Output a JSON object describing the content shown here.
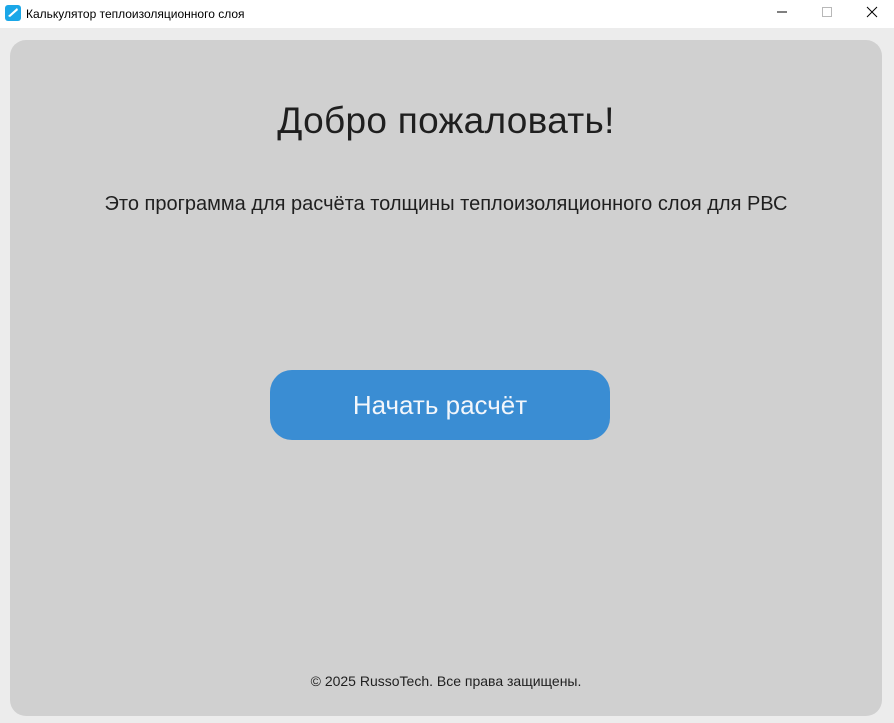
{
  "window": {
    "title": "Калькулятор теплоизоляционного слоя",
    "icon": "app-icon",
    "controls": {
      "minimize_icon": "minimize-icon",
      "maximize_icon": "maximize-icon",
      "close_icon": "close-icon"
    }
  },
  "main": {
    "title": "Добро пожаловать!",
    "description": "Это программа для расчёта толщины теплоизоляционного слоя для РВС",
    "start_button_label": "Начать расчёт",
    "footer": "© 2025 RussoTech. Все права защищены."
  },
  "colors": {
    "background": "#ececec",
    "panel": "#d0d0d0",
    "accent": "#3a8dd3",
    "text": "#1f1f1f"
  }
}
